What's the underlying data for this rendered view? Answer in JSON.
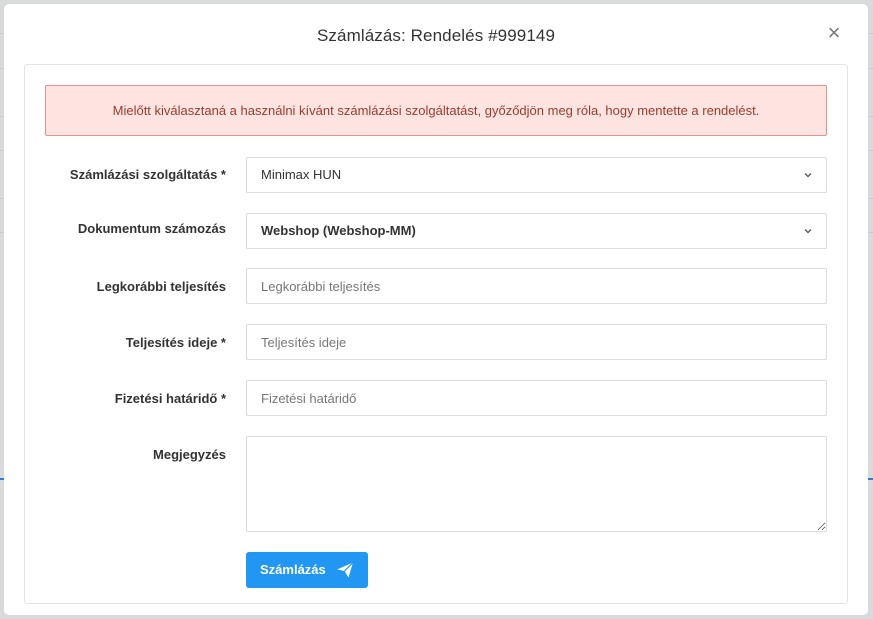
{
  "modal": {
    "title": "Számlázás: Rendelés #999149",
    "close_label": "×"
  },
  "alert": {
    "text": "Mielőtt kiválasztaná a használni kívánt számlázási szolgáltatást, győződjön meg róla, hogy mentette a rendelést."
  },
  "form": {
    "service": {
      "label": "Számlázási szolgáltatás *",
      "value": "Minimax HUN"
    },
    "numbering": {
      "label": "Dokumentum számozás",
      "value": "Webshop (Webshop-MM)"
    },
    "earliest": {
      "label": "Legkorábbi teljesítés",
      "placeholder": "Legkorábbi teljesítés"
    },
    "fulfillment": {
      "label": "Teljesítés ideje *",
      "placeholder": "Teljesítés ideje"
    },
    "deadline": {
      "label": "Fizetési határidő *",
      "placeholder": "Fizetési határidő"
    },
    "note": {
      "label": "Megjegyzés",
      "value": ""
    },
    "submit_label": "Számlázás"
  },
  "colors": {
    "primary": "#2196f3",
    "alert_bg": "#fde4e0",
    "alert_border": "#ee8f85",
    "alert_text": "#9b3b30"
  },
  "icons": {
    "close": "close-icon",
    "chevron": "chevron-down-icon",
    "send": "send-icon"
  }
}
